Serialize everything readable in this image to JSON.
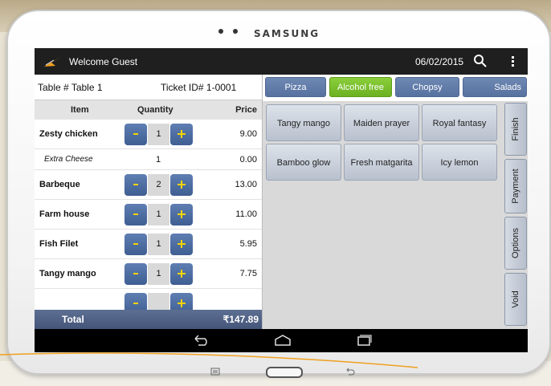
{
  "device": {
    "brand": "SAMSUNG"
  },
  "app": {
    "welcome": "Welcome Guest",
    "date": "06/02/2015",
    "accent": "#f0a020"
  },
  "ticket": {
    "table_label": "Table # Table 1",
    "ticket_label": "Ticket ID# 1-0001"
  },
  "columns": {
    "item": "Item",
    "quantity": "Quantity",
    "price": "Price"
  },
  "items": [
    {
      "name": "Zesty chicken",
      "qty": "1",
      "price": "9.00"
    },
    {
      "name": "Extra Cheese",
      "qty": "1",
      "price": "0.00"
    },
    {
      "name": "Barbeque",
      "qty": "2",
      "price": "13.00"
    },
    {
      "name": "Farm house",
      "qty": "1",
      "price": "11.00"
    },
    {
      "name": "Fish Filet",
      "qty": "1",
      "price": "5.95"
    },
    {
      "name": "Tangy mango",
      "qty": "1",
      "price": "7.75"
    }
  ],
  "total": {
    "label": "Total",
    "value": "₹147.89"
  },
  "categories": [
    {
      "label": "Pizza",
      "active": false
    },
    {
      "label": "Alcohol free",
      "active": true
    },
    {
      "label": "Chopsy",
      "active": false
    },
    {
      "label": "Salads",
      "active": false
    }
  ],
  "products": [
    "Tangy mango",
    "Maiden prayer",
    "Royal fantasy",
    "Bamboo glow",
    "Fresh matgarita",
    "Icy lemon"
  ],
  "side_actions": [
    "Finish",
    "Payment",
    "Options",
    "Void"
  ],
  "icons": {
    "search": "search-icon",
    "menu": "overflow-menu-icon",
    "back": "back-icon",
    "home": "home-icon",
    "recents": "recents-icon"
  }
}
